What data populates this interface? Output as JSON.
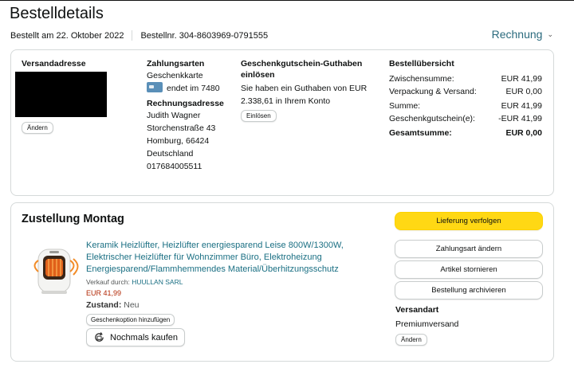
{
  "header": {
    "title": "Bestelldetails",
    "ordered_on": "Bestellt am 22. Oktober 2022",
    "order_number": "Bestellnr. 304-8603969-0791555",
    "invoice_label": "Rechnung"
  },
  "shipping": {
    "heading": "Versandadresse",
    "change_label": "Ändern"
  },
  "payment": {
    "heading": "Zahlungsarten",
    "method": "Geschenkkarte",
    "card_ending": "endet im 7480",
    "billing_heading": "Rechnungsadresse",
    "billing_lines": [
      "Judith Wagner",
      "Storchenstraße 43",
      "Homburg, 66424",
      "Deutschland",
      "017684005511"
    ]
  },
  "giftcard": {
    "heading_line1": "Geschenkgutschein-Guthaben",
    "heading_line2": "einlösen",
    "text_line1": "Sie haben ein Guthaben von EUR",
    "text_line2": "2.338,61 in Ihrem Konto",
    "redeem_label": "Einlösen"
  },
  "summary": {
    "heading": "Bestellübersicht",
    "rows": [
      {
        "label": "Zwischensumme:",
        "value": "EUR 41,99"
      },
      {
        "label": "Verpackung & Versand:",
        "value": "EUR 0,00"
      },
      {
        "label": "Summe:",
        "value": "EUR 41,99"
      },
      {
        "label": "Geschenkgutschein(e):",
        "value": "-EUR 41,99"
      },
      {
        "label": "Gesamtsumme:",
        "value": "EUR 0,00"
      }
    ]
  },
  "delivery": {
    "title": "Zustellung Montag",
    "product_title_lines": [
      "Keramik Heizlüfter, Heizlüfter energiesparend Leise 800W/1300W,",
      "Elektrischer Heizlüfter für Wohnzimmer Büro, Elektroheizung",
      "Energiesparend/Flammhemmendes Material/Überhitzungsschutz"
    ],
    "sold_by_label": "Verkauf durch:",
    "seller": "HUULLAN SARL",
    "price": "EUR 41,99",
    "condition_label": "Zustand:",
    "condition": "Neu",
    "gift_option_label": "Geschenkoption hinzufügen",
    "buy_again_label": "Nochmals kaufen"
  },
  "actions": {
    "track": "Lieferung verfolgen",
    "change_payment": "Zahlungsart ändern",
    "cancel_items": "Artikel stornieren",
    "archive": "Bestellung archivieren"
  },
  "shipping_type": {
    "heading": "Versandart",
    "value": "Premiumversand",
    "change_label": "Ändern"
  },
  "colors": {
    "link": "#1a6f83",
    "primary_button": "#ffd814",
    "price": "#b12704"
  }
}
